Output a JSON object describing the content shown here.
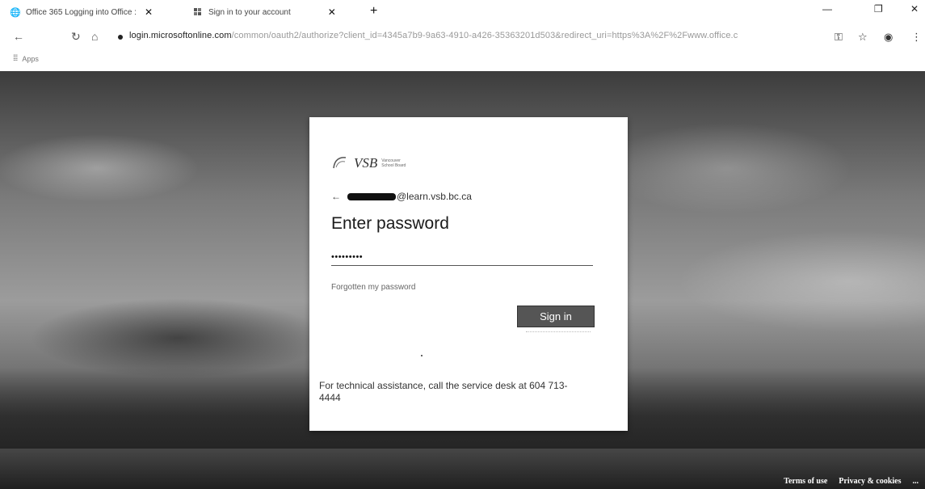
{
  "tabs": [
    {
      "title": "Office 365 Logging into Office :",
      "icon": "globe-icon"
    },
    {
      "title": "Sign in to your account",
      "icon": "microsoft-logo-icon"
    }
  ],
  "address": {
    "host": "login.microsoftonline.com",
    "path": "/common/oauth2/authorize?client_id=4345a7b9-9a63-4910-a426-35363201d503&redirect_uri=https%3A%2F%2Fwww.office.c"
  },
  "bookmarks": {
    "apps_label": "Apps"
  },
  "login": {
    "org_name_logo": "VSB",
    "org_subtitle": "Vancouver School Board",
    "email_suffix": "@learn.vsb.bc.ca",
    "heading": "Enter password",
    "password_value": "•••••••••",
    "forgot_link": "Forgotten my password",
    "signin_button": "Sign in",
    "help_text": "For technical assistance, call the service desk at 604 713-4444"
  },
  "footer": {
    "terms": "Terms of use",
    "privacy": "Privacy & cookies",
    "more": "..."
  }
}
